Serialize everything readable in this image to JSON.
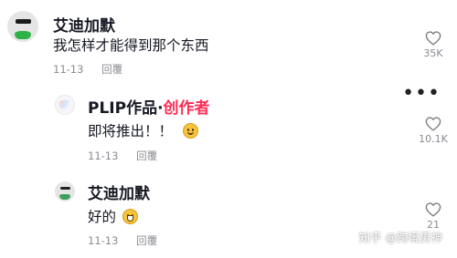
{
  "comments": [
    {
      "username": "艾迪加默",
      "text": "我怎样才能得到那个东西",
      "date": "11-13",
      "reply_label": "回覆",
      "like_count": "35K"
    },
    {
      "username": "PLIP作品",
      "creator_separator": "·",
      "creator_tag": "创作者",
      "text": "即将推出！！",
      "date": "11-13",
      "reply_label": "回覆",
      "like_count": "10.1K"
    },
    {
      "username": "艾迪加默",
      "text": "好的",
      "date": "11-13",
      "reply_label": "回覆",
      "like_count": "21"
    }
  ],
  "more_options_label": "•••",
  "watermark": "知乎 @跨境男神",
  "colors": {
    "creator_tag": "#fe2c55",
    "meta_text": "#8a8b91",
    "avatar_accent": "#2fb14a"
  },
  "icons": {
    "like": "heart-outline-icon",
    "more": "more-options-icon",
    "emoji_1": "wink-smile-emoji-icon",
    "emoji_2": "grin-emoji-icon"
  }
}
